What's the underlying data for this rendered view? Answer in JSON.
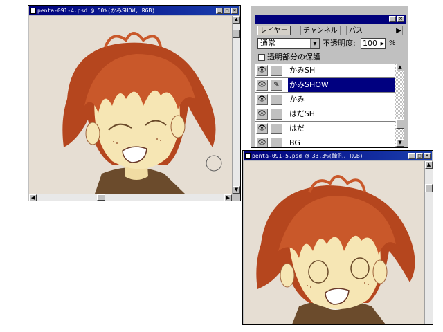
{
  "window1": {
    "title": "penta-091-4.psd @ 50%(かみSHOW, RGB)",
    "btn_min": "_",
    "btn_max": "□",
    "btn_close": "×"
  },
  "window2": {
    "title": "penta-091-5.psd @ 33.3%(瞳孔, RGB)",
    "btn_min": "_",
    "btn_max": "□",
    "btn_close": "×"
  },
  "layers_palette": {
    "tabs": [
      {
        "label": "レイヤー"
      },
      {
        "label": "チャンネル"
      },
      {
        "label": "パス"
      }
    ],
    "menu_arrow": "▶",
    "blend_mode": "通常",
    "opacity_label": "不透明度:",
    "opacity_value": "100",
    "opacity_unit": "%",
    "preserve_transparency_label": "透明部分の保護",
    "preserve_transparency_checked": false,
    "layers": [
      {
        "name": "かみSH",
        "visible": true,
        "selected": false,
        "brush": ""
      },
      {
        "name": "かみSHOW",
        "visible": true,
        "selected": true,
        "brush": "✎"
      },
      {
        "name": "かみ",
        "visible": true,
        "selected": false,
        "brush": ""
      },
      {
        "name": "はだSH",
        "visible": true,
        "selected": false,
        "brush": ""
      },
      {
        "name": "はだ",
        "visible": true,
        "selected": false,
        "brush": ""
      },
      {
        "name": "BG",
        "visible": true,
        "selected": false,
        "brush": ""
      }
    ],
    "eye_glyph": "👁"
  },
  "colors": {
    "canvas_bg": "#e6ded3",
    "hair": "#c9582a",
    "skin": "#f6e6b4",
    "shirt": "#6b4b2c",
    "title_bar": "#00007b",
    "selection": "#000080"
  }
}
